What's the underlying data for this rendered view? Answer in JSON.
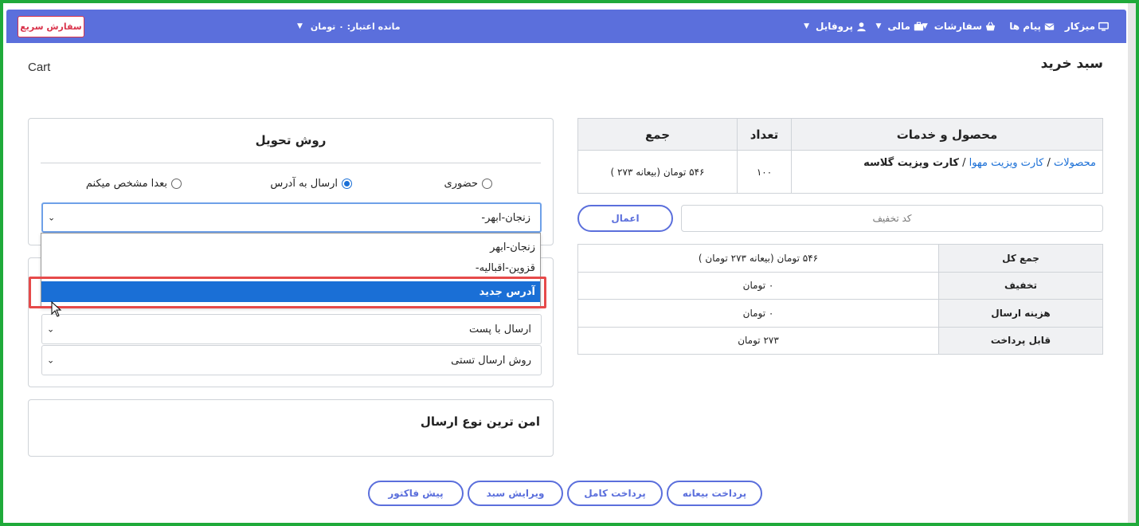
{
  "nav": {
    "dashboard": "میزکار",
    "messages": "پیام ها",
    "orders": "سفارشات",
    "finance": "مالی",
    "profile": "پروفایل",
    "credit": "مانده اعتبار: ۰ تومان",
    "quick_order": "سفارش سریع"
  },
  "page": {
    "title": "سبد خرید",
    "subtitle": "Cart"
  },
  "delivery": {
    "title": "روش تحویل",
    "options": [
      "حضوری",
      "ارسال به آدرس",
      "بعدا مشخص میکنم"
    ],
    "selected_option": "ارسال به آدرس",
    "address_value": "زنجان-ابهر-",
    "dropdown_options": [
      "زنجان-ابهر",
      "قزوین-اقبالیه-",
      "آدرس جدید"
    ],
    "dropdown_highlighted": "آدرس جدید"
  },
  "shipping": {
    "selects": [
      "ارسال با پست",
      "روش ارسال تستی"
    ]
  },
  "safe": {
    "title": "امن ترین نوع ارسال"
  },
  "cart_table": {
    "headers": [
      "محصول و خدمات",
      "تعداد",
      "جمع"
    ],
    "row": {
      "breadcrumb_1": "محصولات",
      "breadcrumb_sep": "/",
      "breadcrumb_2": "کارت ویزیت مهوا",
      "product": "کارت ویزیت گلاسه",
      "quantity": "۱۰۰",
      "total": "۵۴۶ تومان (بیعانه ۲۷۳ )"
    }
  },
  "coupon": {
    "placeholder": "کد تخفیف",
    "apply": "اعمال"
  },
  "summary": [
    {
      "label": "جمع کل",
      "value": "۵۴۶ تومان (بیعانه ۲۷۳ تومان )"
    },
    {
      "label": "تخفیف",
      "value": "۰ تومان"
    },
    {
      "label": "هزینه ارسال",
      "value": "۰ تومان"
    },
    {
      "label": "قابل پرداخت",
      "value": "۲۷۳ تومان"
    }
  ],
  "actions": {
    "deposit": "پرداخت بیعانه",
    "full": "پرداخت کامل",
    "edit": "ویرایش سبد",
    "invoice": "پیش فاکتور"
  },
  "colors": {
    "navbar": "#5b6fdc",
    "accent_red": "#d9344c",
    "select_blue": "#1a6fd6",
    "frame_green": "#1faa3a"
  }
}
